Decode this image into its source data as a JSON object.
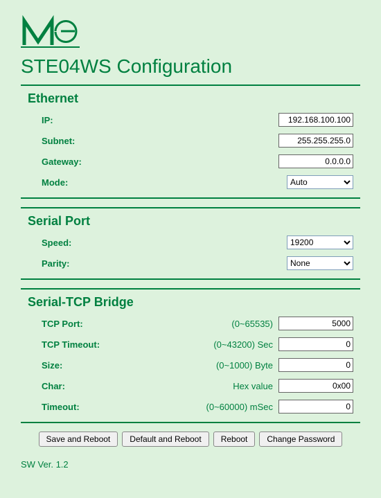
{
  "page_title": "STE04WS Configuration",
  "ethernet": {
    "title": "Ethernet",
    "ip_label": "IP:",
    "ip_value": "192.168.100.100",
    "subnet_label": "Subnet:",
    "subnet_value": "255.255.255.0",
    "gateway_label": "Gateway:",
    "gateway_value": "0.0.0.0",
    "mode_label": "Mode:",
    "mode_value": "Auto"
  },
  "serial": {
    "title": "Serial Port",
    "speed_label": "Speed:",
    "speed_value": "19200",
    "parity_label": "Parity:",
    "parity_value": "None"
  },
  "bridge": {
    "title": "Serial-TCP Bridge",
    "tcp_port_label": "TCP Port:",
    "tcp_port_hint": "(0~65535)",
    "tcp_port_value": "5000",
    "tcp_timeout_label": "TCP Timeout:",
    "tcp_timeout_hint": "(0~43200) Sec",
    "tcp_timeout_value": "0",
    "size_label": "Size:",
    "size_hint": "(0~1000) Byte",
    "size_value": "0",
    "char_label": "Char:",
    "char_hint": "Hex value",
    "char_value": "0x00",
    "timeout_label": "Timeout:",
    "timeout_hint": "(0~60000) mSec",
    "timeout_value": "0"
  },
  "buttons": {
    "save_reboot": "Save and Reboot",
    "default_reboot": "Default and Reboot",
    "reboot": "Reboot",
    "change_password": "Change Password"
  },
  "version": "SW Ver. 1.2"
}
